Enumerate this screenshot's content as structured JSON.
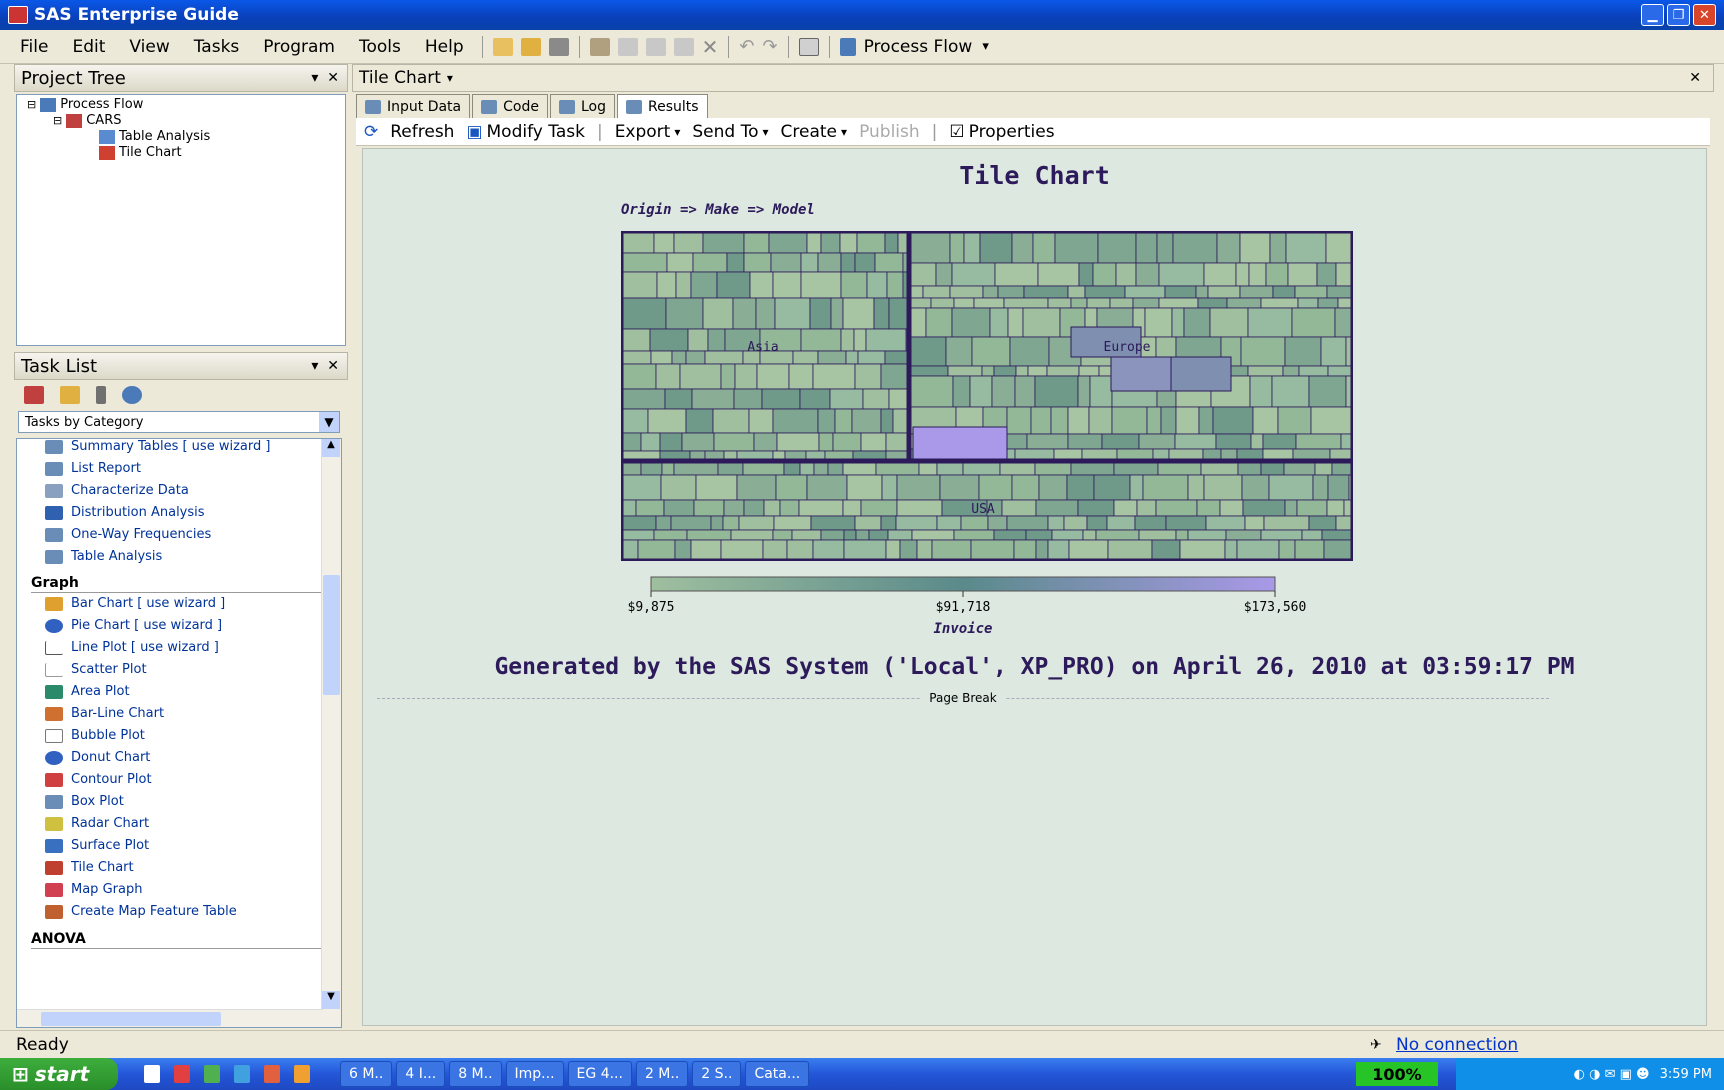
{
  "window": {
    "title": "SAS Enterprise Guide"
  },
  "menu": [
    "File",
    "Edit",
    "View",
    "Tasks",
    "Program",
    "Tools",
    "Help"
  ],
  "toolbar": {
    "process_flow": "Process Flow"
  },
  "project_tree": {
    "title": "Project Tree",
    "items": [
      "Process Flow",
      "CARS",
      "Table Analysis",
      "Tile Chart"
    ]
  },
  "task_list": {
    "title": "Task List",
    "dropdown": "Tasks by Category",
    "items_top": [
      "Summary Tables  [ use wizard ]",
      "List Report",
      "Characterize Data",
      "Distribution Analysis",
      "One-Way Frequencies",
      "Table Analysis"
    ],
    "graph_label": "Graph",
    "graph_items": [
      "Bar Chart  [ use wizard ]",
      "Pie Chart  [ use wizard ]",
      "Line Plot  [ use wizard ]",
      "Scatter Plot",
      "Area Plot",
      "Bar-Line Chart",
      "Bubble Plot",
      "Donut Chart",
      "Contour Plot",
      "Box Plot",
      "Radar Chart",
      "Surface Plot",
      "Tile Chart",
      "Map Graph",
      "Create Map Feature Table"
    ],
    "anova_label": "ANOVA"
  },
  "workspace": {
    "title": "Tile Chart",
    "tabs": [
      "Input Data",
      "Code",
      "Log",
      "Results"
    ],
    "actions": [
      "Refresh",
      "Modify Task",
      "Export",
      "Send To",
      "Create",
      "Publish",
      "Properties"
    ]
  },
  "report": {
    "title": "Tile Chart",
    "footnote": "Generated by the SAS System ('Local', XP_PRO) on April 26, 2010 at 03:59:17 PM",
    "page_break": "Page Break"
  },
  "status": {
    "left": "Ready",
    "right": "No connection"
  },
  "taskbar": {
    "start": "start",
    "buttons": [
      "6 M..",
      "4 I...",
      "8 M..",
      "Imp...",
      "EG 4...",
      "2 M..",
      "2 S..",
      "Cata..."
    ],
    "zoom": "100%",
    "clock": "3:59 PM"
  },
  "chart_data": {
    "type": "heatmap",
    "subtitle": "Origin => Make => Model",
    "regions": [
      {
        "name": "Asia"
      },
      {
        "name": "Europe"
      },
      {
        "name": "USA"
      }
    ],
    "legend": {
      "title": "Invoice",
      "ticks": [
        "$9,875",
        "$91,718",
        "$173,560"
      ],
      "min": 9875,
      "max": 173560,
      "colors": [
        "#9fbf9f",
        "#5a8a8a",
        "#a999e8"
      ]
    }
  }
}
